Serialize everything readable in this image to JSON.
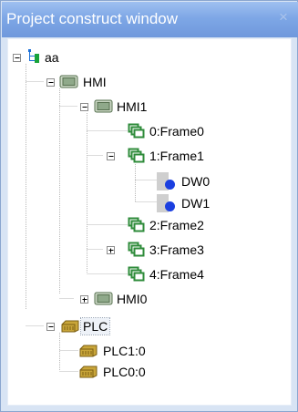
{
  "window": {
    "title": "Project construct window",
    "close_glyph": "×"
  },
  "tree": {
    "root": "aa",
    "hmi": "HMI",
    "hmi1": "HMI1",
    "frame0": "0:Frame0",
    "frame1": "1:Frame1",
    "dw0": "DW0",
    "dw1": "DW1",
    "frame2": "2:Frame2",
    "frame3": "3:Frame3",
    "frame4": "4:Frame4",
    "hmi0": "HMI0",
    "plc": "PLC",
    "plc1": "PLC1:0",
    "plc0": "PLC0:0"
  },
  "colors": {
    "title_bar": "#7ea7e6",
    "frame_icon": "#2e8b3a",
    "monitor_icon": "#7f9f7a",
    "plc_icon": "#b08f2c",
    "dw_dot": "#1b3fe0"
  }
}
